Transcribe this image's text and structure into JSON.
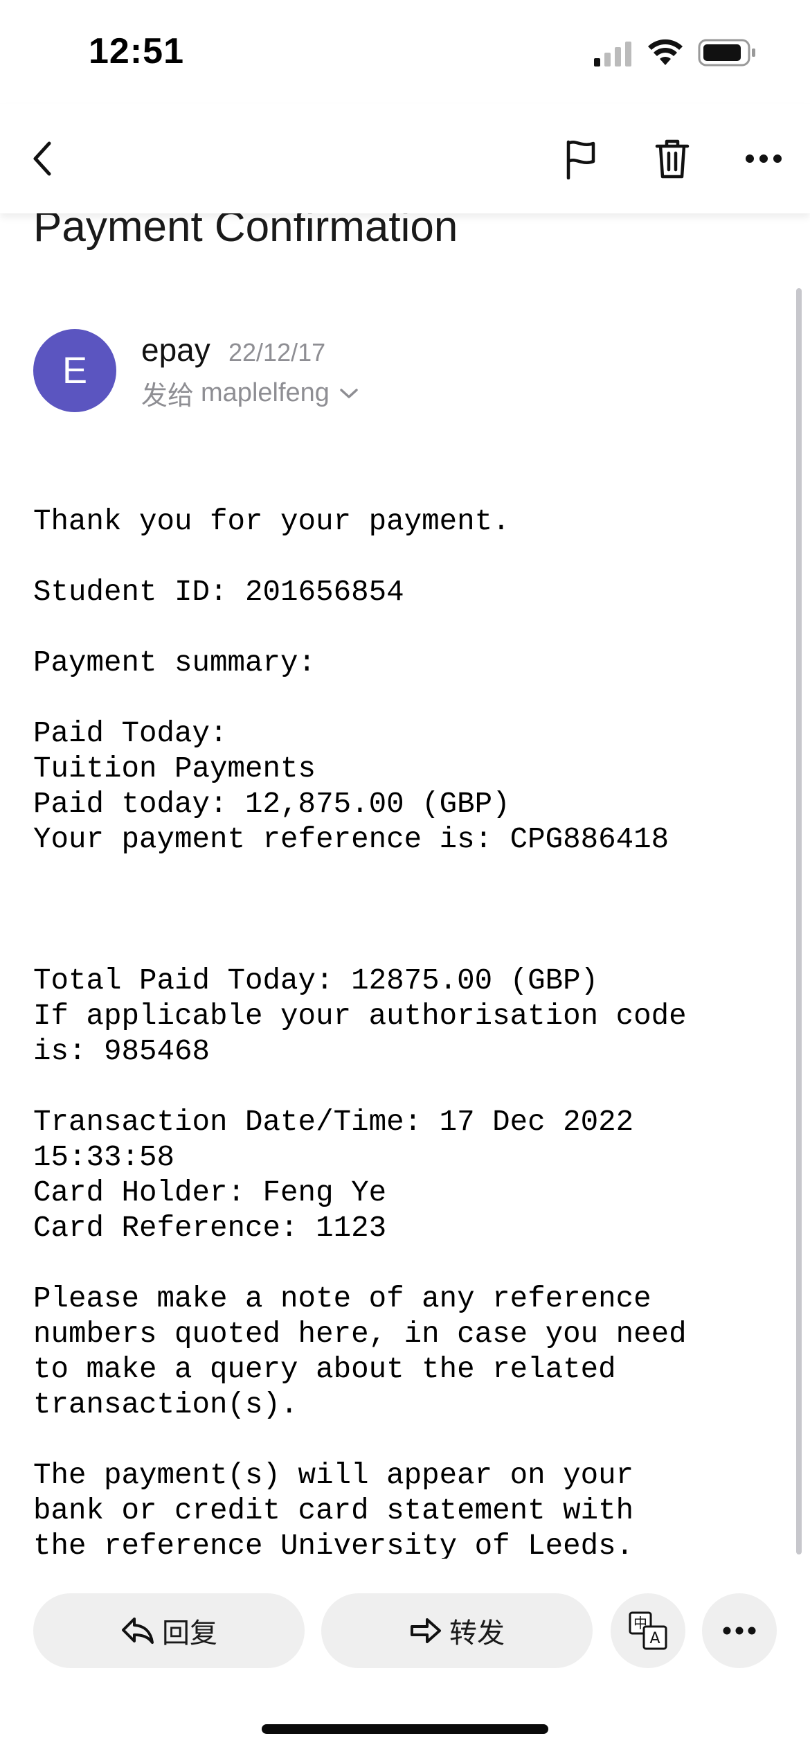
{
  "status_bar": {
    "time": "12:51",
    "icons": [
      "signal-icon",
      "wifi-icon",
      "battery-icon"
    ]
  },
  "nav": {
    "icons": [
      "back-chevron-icon",
      "flag-icon",
      "trash-icon",
      "more-horizontal-icon"
    ]
  },
  "email": {
    "subject": "Payment Confirmation",
    "sender": {
      "initial": "E",
      "name": "epay",
      "date": "22/12/17",
      "to_label": "发给",
      "recipient": "maplelfeng",
      "avatar_color": "#5b55c0"
    },
    "body": "Thank you for your payment.\n\nStudent ID: 201656854\n\nPayment summary:\n\nPaid Today:\nTuition Payments\nPaid today: 12,875.00 (GBP)\nYour payment reference is: CPG886418\n\n\n\nTotal Paid Today: 12875.00 (GBP)\nIf applicable your authorisation code\nis: 985468\n\nTransaction Date/Time: 17 Dec 2022\n15:33:58\nCard Holder: Feng Ye\nCard Reference: 1123\n\nPlease make a note of any reference\nnumbers quoted here, in case you need\nto make a query about the related\ntransaction(s).\n\nThe payment(s) will appear on your\nbank or credit card statement with\nthe reference University of Leeds."
  },
  "toolbar": {
    "reply_label": "回复",
    "forward_label": "转发",
    "icons": [
      "reply-icon",
      "forward-icon",
      "translate-icon",
      "more-horizontal-icon"
    ]
  },
  "colors": {
    "accent": "#5b55c0",
    "secondary_text": "#8e8e93",
    "pill_background": "#efefef"
  }
}
